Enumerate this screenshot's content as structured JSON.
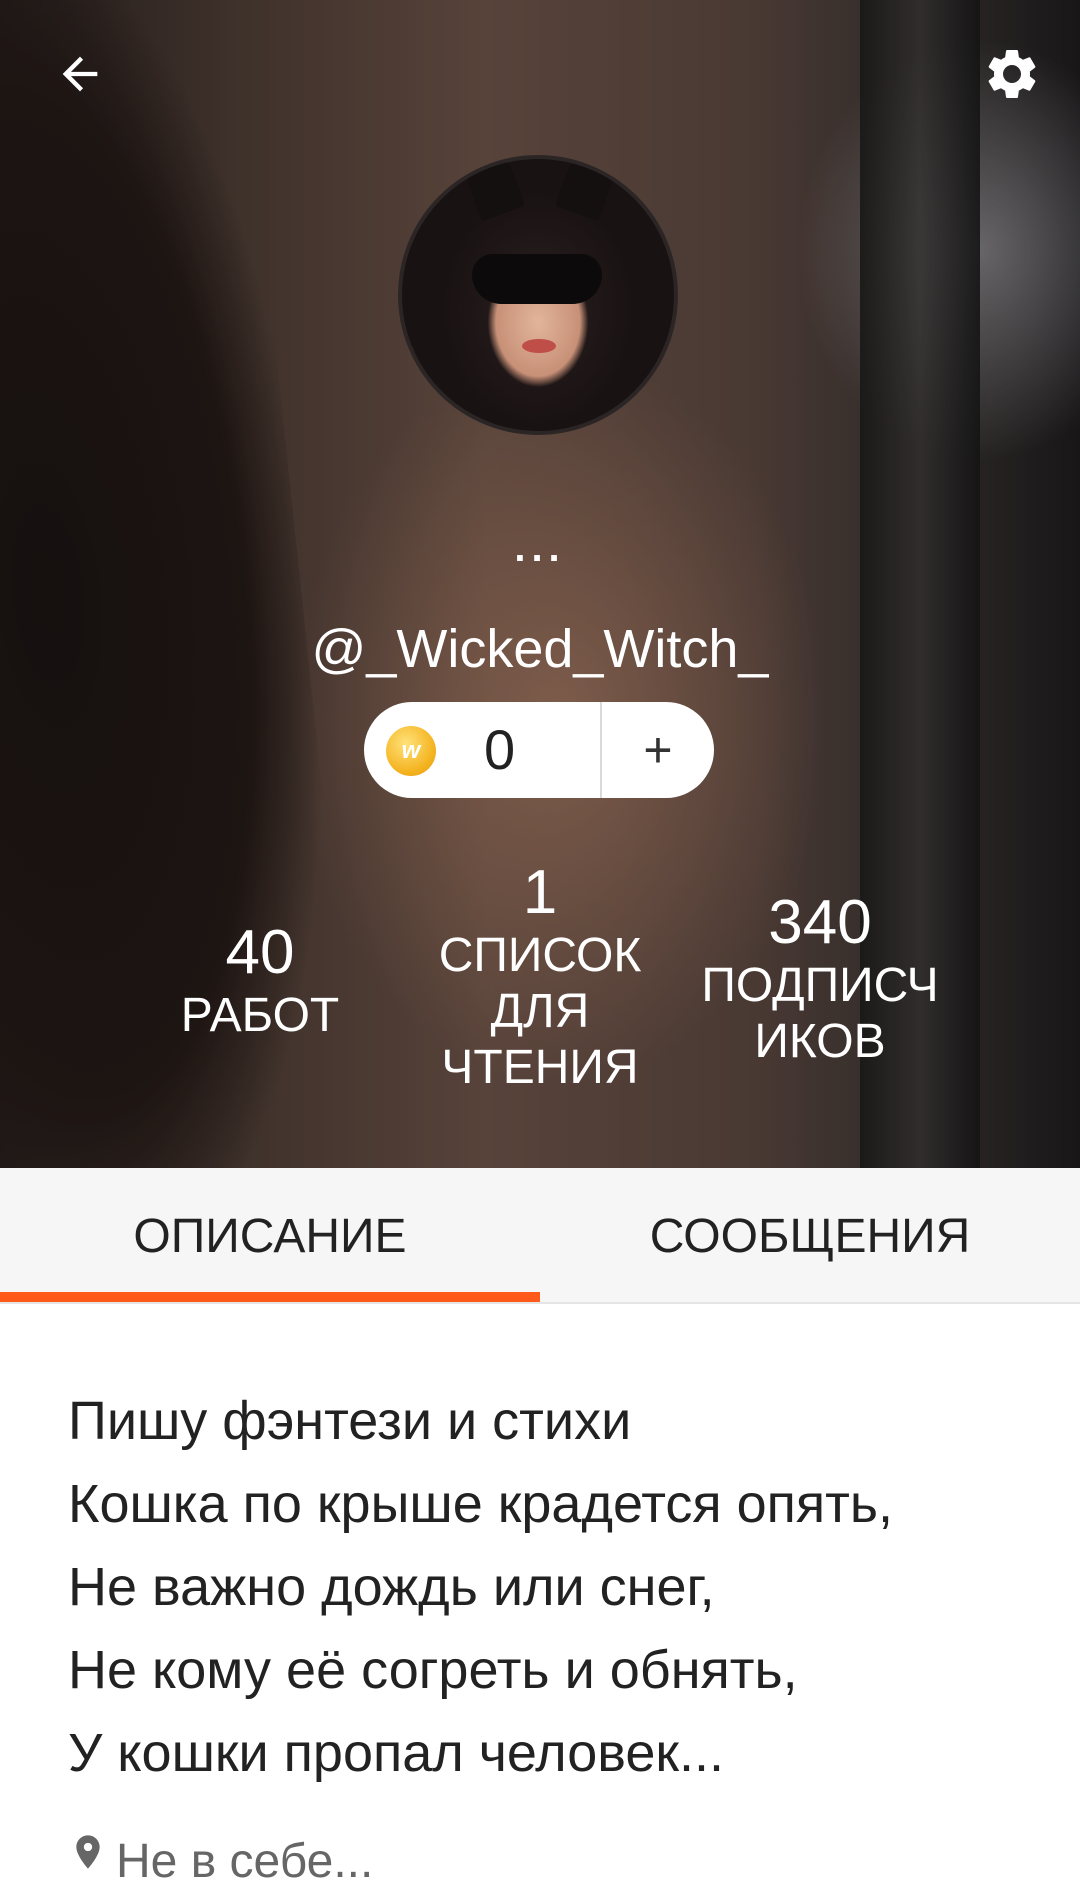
{
  "header": {
    "back_icon": "arrow-left-icon",
    "settings_icon": "gear-icon",
    "more_label": "...",
    "username": "@_Wicked_Witch_"
  },
  "coins": {
    "icon": "wattpad-coin-icon",
    "icon_letter": "w",
    "count": "0",
    "plus_label": "+"
  },
  "stats": [
    {
      "value": "40",
      "label": "РАБОТ"
    },
    {
      "value": "1",
      "label": "СПИСОК ДЛЯ ЧТЕНИЯ"
    },
    {
      "value": "340",
      "label": "ПОДПИСЧИКОВ"
    }
  ],
  "stat_label_lines": {
    "reading_lists": [
      "СПИСОК",
      "ДЛЯ",
      "ЧТЕНИЯ"
    ],
    "followers": [
      "ПОДПИСЧ",
      "ИКОВ"
    ]
  },
  "tabs": [
    {
      "label": "ОПИСАНИЕ",
      "active": true
    },
    {
      "label": "СООБЩЕНИЯ",
      "active": false
    }
  ],
  "bio": {
    "lines": [
      "Пишу фэнтези и стихи",
      "Кошка по крыше крадется опять,",
      "Не важно дождь или снег,",
      "Не кому её согреть и обнять,",
      "У кошки пропал человек..."
    ]
  },
  "location": {
    "icon": "location-pin-icon",
    "text": "Не в себе..."
  },
  "colors": {
    "accent": "#ff5a1a",
    "coin": "#f4b320",
    "tab_bar": "#f7f6f7"
  }
}
